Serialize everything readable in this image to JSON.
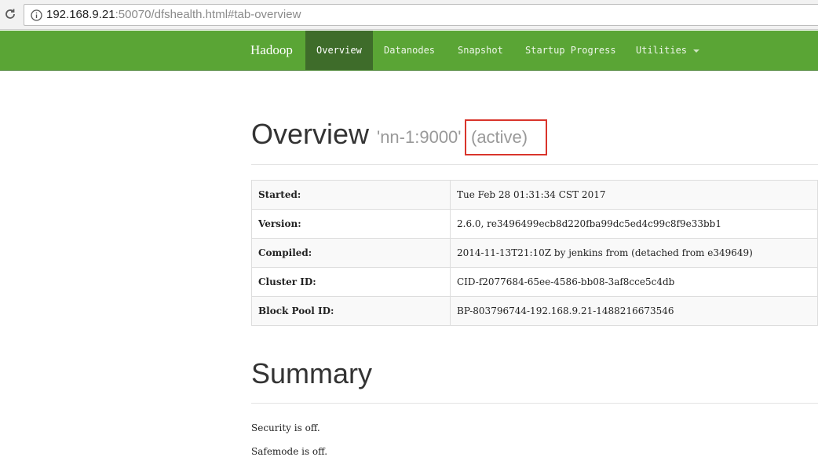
{
  "browser": {
    "url_host": "192.168.9.21",
    "url_rest": ":50070/dfshealth.html#tab-overview"
  },
  "navbar": {
    "brand": "Hadoop",
    "items": [
      {
        "label": "Overview",
        "active": true
      },
      {
        "label": "Datanodes"
      },
      {
        "label": "Snapshot"
      },
      {
        "label": "Startup Progress"
      },
      {
        "label": "Utilities",
        "dropdown": true
      }
    ],
    "bg_color": "#5aa535",
    "active_color": "#3e6c2a"
  },
  "overview": {
    "title": "Overview",
    "node": "'nn-1:9000'",
    "state": "(active)",
    "highlight_color": "#d9342b",
    "rows": [
      {
        "key": "Started:",
        "value": "Tue Feb 28 01:31:34 CST 2017"
      },
      {
        "key": "Version:",
        "value": "2.6.0, re3496499ecb8d220fba99dc5ed4c99c8f9e33bb1"
      },
      {
        "key": "Compiled:",
        "value": "2014-11-13T21:10Z by jenkins from (detached from e349649)"
      },
      {
        "key": "Cluster ID:",
        "value": "CID-f2077684-65ee-4586-bb08-3af8cce5c4db"
      },
      {
        "key": "Block Pool ID:",
        "value": "BP-803796744-192.168.9.21-1488216673546"
      }
    ]
  },
  "summary": {
    "title": "Summary",
    "lines": [
      "Security is off.",
      "Safemode is off."
    ]
  }
}
